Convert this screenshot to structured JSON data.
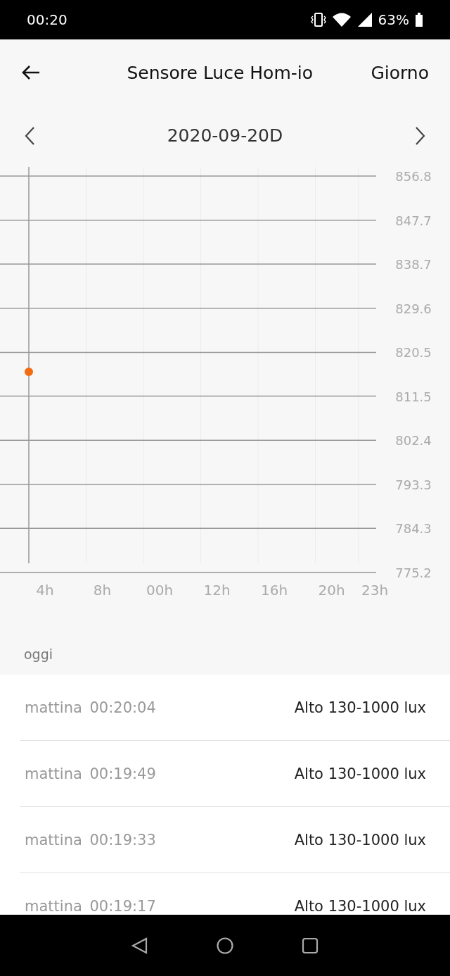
{
  "status_bar": {
    "time": "00:20",
    "battery": "63%"
  },
  "header": {
    "title": "Sensore Luce Hom-io",
    "period": "Giorno"
  },
  "date_nav": {
    "date": "2020-09-20D"
  },
  "chart": {
    "chart_data": {
      "type": "scatter",
      "categories": [
        "4h",
        "8h",
        "00h",
        "12h",
        "16h",
        "20h",
        "23h"
      ],
      "series": [
        {
          "color": "#f26b0f",
          "values": [
            816.5,
            null,
            null,
            null,
            null,
            null,
            null
          ]
        }
      ],
      "ylim": [
        775.2,
        856.8
      ],
      "grid": true,
      "yticks": [
        856.8,
        847.7,
        838.7,
        829.6,
        820.5,
        811.5,
        802.4,
        793.3,
        784.3,
        775.2
      ]
    }
  },
  "section_label": "oggi",
  "records": [
    {
      "period": "mattina",
      "time": "00:20:04",
      "value": "Alto 130-1000 lux"
    },
    {
      "period": "mattina",
      "time": "00:19:49",
      "value": "Alto 130-1000 lux"
    },
    {
      "period": "mattina",
      "time": "00:19:33",
      "value": "Alto 130-1000 lux"
    },
    {
      "period": "mattina",
      "time": "00:19:17",
      "value": "Alto 130-1000 lux"
    }
  ]
}
